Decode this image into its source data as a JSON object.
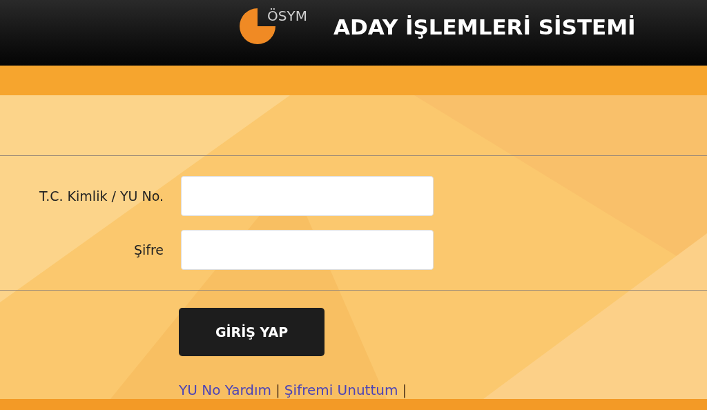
{
  "header": {
    "logo_text": "ÖSYM",
    "title": "ADAY İŞLEMLERİ SİSTEMİ"
  },
  "form": {
    "fields": [
      {
        "label": "T.C. Kimlik / YU No."
      },
      {
        "label": "Şifre"
      }
    ],
    "submit": "GİRİŞ YAP"
  },
  "links": [
    {
      "label": "YU No Yardım",
      "separator": "|"
    },
    {
      "label": "Şifremi Unuttum",
      "separator": "|"
    }
  ]
}
